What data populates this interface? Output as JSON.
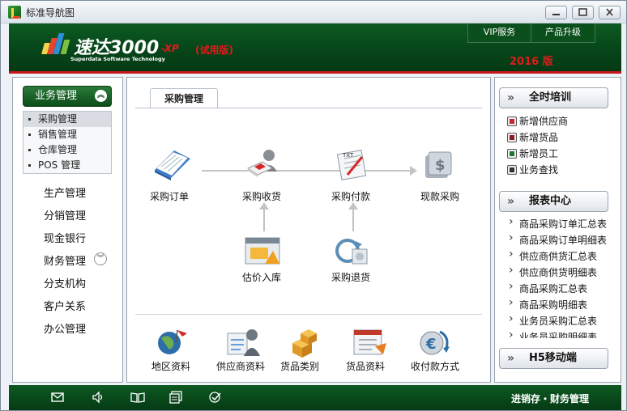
{
  "window": {
    "title": "标准导航图",
    "controls": [
      "minimize",
      "maximize",
      "close"
    ]
  },
  "header": {
    "brand": "速达3000",
    "brand_suffix": "-XP",
    "trial": "(试用版)",
    "brand_sub": "Superdata Software Technology",
    "buttons": [
      "VIP服务",
      "产品升级"
    ],
    "edition": "2016 版",
    "colors": {
      "green": "#064419",
      "red": "#c8161d"
    }
  },
  "sidebar": {
    "active_group": "业务管理",
    "sub_items": [
      "采购管理",
      "销售管理",
      "仓库管理",
      "POS 管理"
    ],
    "active_sub": "采购管理",
    "items": [
      "生产管理",
      "分销管理",
      "现金银行",
      "财务管理",
      "分支机构",
      "客户关系",
      "办公管理"
    ]
  },
  "main": {
    "tab": "采购管理",
    "flow": {
      "top": [
        "采购订单",
        "采购收货",
        "采购付款",
        "现款采购"
      ],
      "bottom": [
        "估价入库",
        "采购退货"
      ]
    },
    "shortcuts": [
      "地区资料",
      "供应商资料",
      "货品类别",
      "货品资料",
      "收付款方式"
    ]
  },
  "rightbar": {
    "training": {
      "title": "全时培训",
      "links": [
        "新增供应商",
        "新增货品",
        "新增员工",
        "业务查找"
      ]
    },
    "reports": {
      "title": "报表中心",
      "links": [
        "商品采购订单汇总表",
        "商品采购订单明细表",
        "供应商供货汇总表",
        "供应商供货明细表",
        "商品采购汇总表",
        "商品采购明细表",
        "业务员采购汇总表",
        "业务员采购明细表"
      ]
    },
    "h5": {
      "title": "H5移动端"
    }
  },
  "footer": {
    "icons": [
      "mail-icon",
      "speaker-icon",
      "book-icon",
      "window-icon",
      "check-icon"
    ],
    "text": "进销存・财务管理"
  }
}
